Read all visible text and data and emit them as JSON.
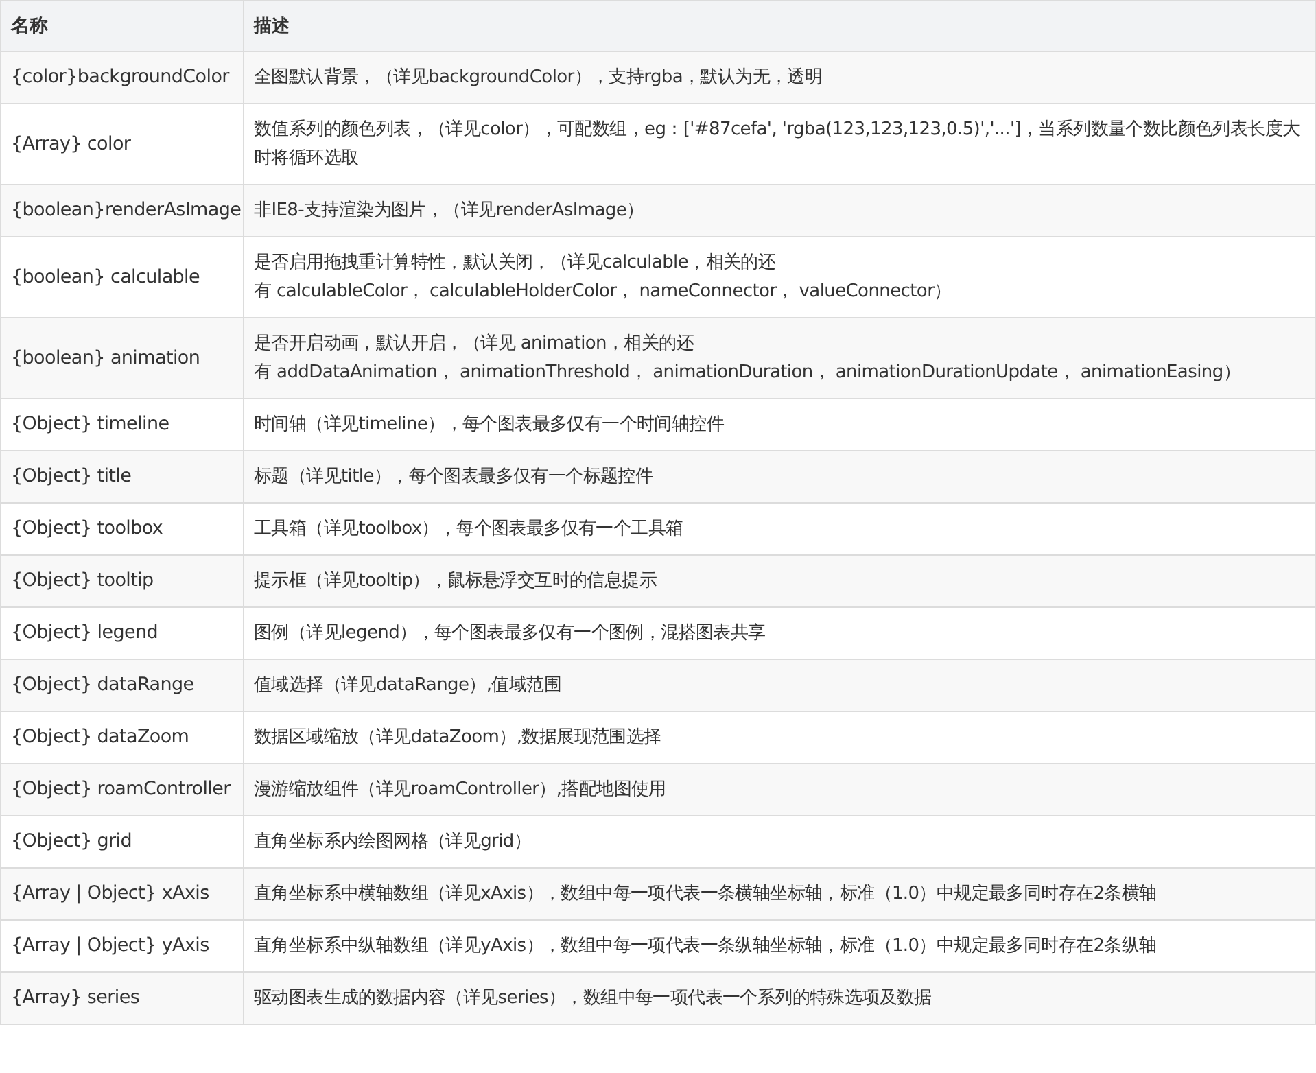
{
  "table": {
    "columns": [
      "名称",
      "描述"
    ],
    "rows": [
      {
        "name": "{color}backgroundColor",
        "description": "全图默认背景，（详见backgroundColor），支持rgba，默认为无，透明"
      },
      {
        "name": "{Array} color",
        "description": "数值系列的颜色列表，（详见color），可配数组，eg：['#87cefa', 'rgba(123,123,123,0.5)','...']，当系列数量个数比颜色列表长度大时将循环选取"
      },
      {
        "name": "{boolean}renderAsImage",
        "description": "非IE8-支持渲染为图片，（详见renderAsImage）"
      },
      {
        "name": "{boolean} calculable",
        "description_lines": [
          "是否启用拖拽重计算特性，默认关闭，（详见calculable，相关的还",
          "有 calculableColor， calculableHolderColor， nameConnector， valueConnector）"
        ]
      },
      {
        "name": "{boolean} animation",
        "description_lines": [
          "是否开启动画，默认开启，（详见 animation，相关的还",
          "有 addDataAnimation， animationThreshold， animationDuration， animationDurationUpdate， animationEasing）"
        ]
      },
      {
        "name": "{Object} timeline",
        "description": "时间轴（详见timeline），每个图表最多仅有一个时间轴控件"
      },
      {
        "name": "{Object} title",
        "description": "标题（详见title），每个图表最多仅有一个标题控件"
      },
      {
        "name": "{Object} toolbox",
        "description": "工具箱（详见toolbox），每个图表最多仅有一个工具箱"
      },
      {
        "name": "{Object} tooltip",
        "description": "提示框（详见tooltip），鼠标悬浮交互时的信息提示"
      },
      {
        "name": "{Object} legend",
        "description": "图例（详见legend），每个图表最多仅有一个图例，混搭图表共享"
      },
      {
        "name": "{Object} dataRange",
        "description": "值域选择（详见dataRange）,值域范围"
      },
      {
        "name": "{Object} dataZoom",
        "description": "数据区域缩放（详见dataZoom）,数据展现范围选择"
      },
      {
        "name": "{Object} roamController",
        "description": "漫游缩放组件（详见roamController）,搭配地图使用"
      },
      {
        "name": "{Object} grid",
        "description": "直角坐标系内绘图网格（详见grid）"
      },
      {
        "name": "{Array | Object} xAxis",
        "description": "直角坐标系中横轴数组（详见xAxis），数组中每一项代表一条横轴坐标轴，标准（1.0）中规定最多同时存在2条横轴"
      },
      {
        "name": "{Array | Object} yAxis",
        "description": "直角坐标系中纵轴数组（详见yAxis），数组中每一项代表一条纵轴坐标轴，标准（1.0）中规定最多同时存在2条纵轴"
      },
      {
        "name": "{Array} series",
        "description": "驱动图表生成的数据内容（详见series），数组中每一项代表一个系列的特殊选项及数据"
      }
    ]
  }
}
